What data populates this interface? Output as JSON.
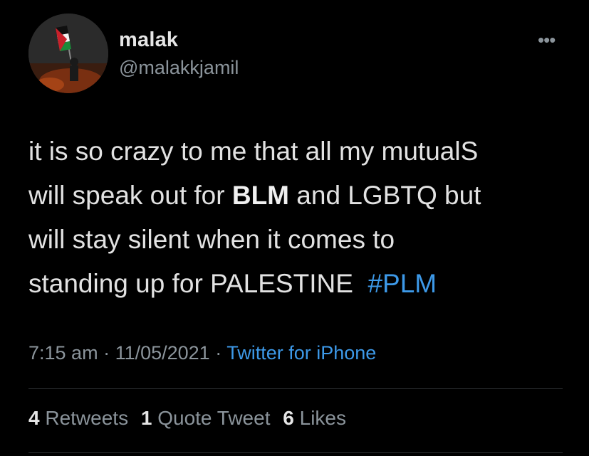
{
  "user": {
    "display_name": "malak",
    "handle": "@malakkjamil"
  },
  "more_icon": "•••",
  "tweet": {
    "line1": "it is so crazy to me that all my mutualS",
    "line2_a": "will speak out for ",
    "line2_bold": "BLM",
    "line2_b": " and LGBTQ but",
    "line3": "will stay silent when it comes to",
    "line4": "standing up for PALESTINE  ",
    "hashtag": "#PLM"
  },
  "meta": {
    "time": "7:15 am",
    "sep1": " · ",
    "date": "11/05/2021",
    "sep2": " · ",
    "source": "Twitter for iPhone"
  },
  "stats": {
    "retweets_count": "4",
    "retweets_label": "Retweets",
    "quotes_count": "1",
    "quotes_label": "Quote Tweet",
    "likes_count": "6",
    "likes_label": "Likes"
  },
  "colors": {
    "background": "#000000",
    "link": "#3d99e8",
    "secondary_text": "#8b949b",
    "primary_text": "#e2e2e2"
  }
}
